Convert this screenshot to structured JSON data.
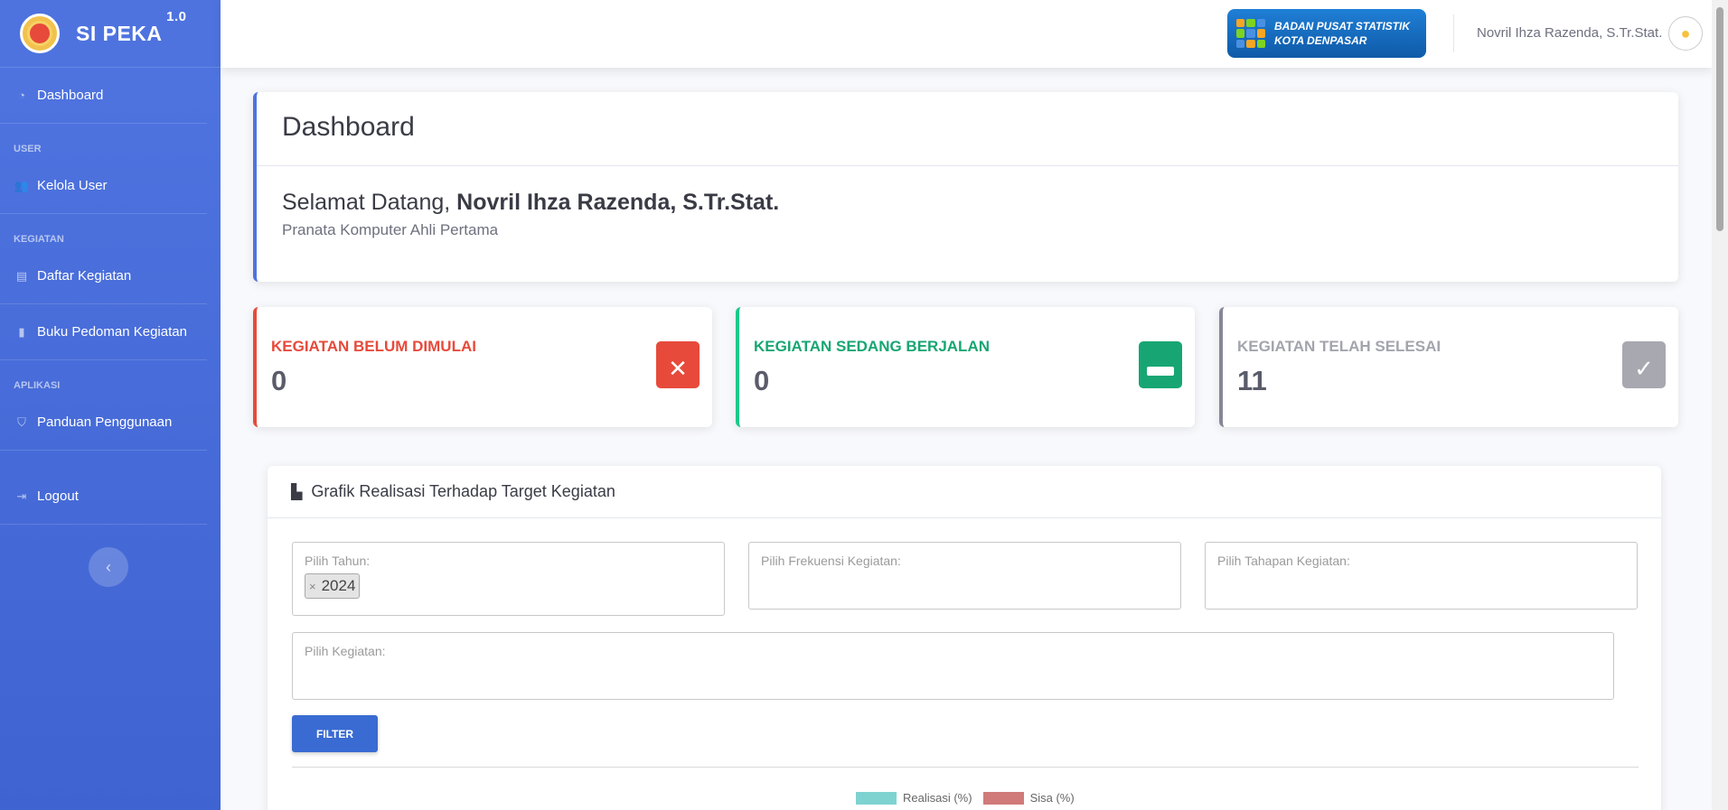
{
  "brand": {
    "name": "SI PEKA",
    "version": "1.0"
  },
  "sidebar": {
    "dashboard": "Dashboard",
    "heading_user": "USER",
    "kelola_user": "Kelola User",
    "heading_kegiatan": "KEGIATAN",
    "daftar_kegiatan": "Daftar Kegiatan",
    "buku_pedoman": "Buku Pedoman Kegiatan",
    "heading_aplikasi": "APLIKASI",
    "panduan": "Panduan Penggunaan",
    "logout": "Logout"
  },
  "topbar": {
    "bps_line1": "BADAN PUSAT STATISTIK",
    "bps_line2": "KOTA DENPASAR",
    "user_name": "Novril Ihza Razenda, S.Tr.Stat."
  },
  "welcome": {
    "title": "Dashboard",
    "greeting_prefix": "Selamat Datang, ",
    "greeting_name": "Novril Ihza Razenda, S.Tr.Stat.",
    "role": "Pranata Komputer Ahli Pertama"
  },
  "stats": [
    {
      "title": "KEGIATAN BELUM DIMULAI",
      "value": "0",
      "color": "#e74a3b",
      "icon": "calendar-x-icon"
    },
    {
      "title": "KEGIATAN SEDANG BERJALAN",
      "value": "0",
      "color": "#1cc88a",
      "icon": "calendar-minus-icon"
    },
    {
      "title": "KEGIATAN TELAH SELESAI",
      "value": "11",
      "color": "#858796",
      "icon": "calendar-check-icon"
    }
  ],
  "chart_section": {
    "title": "Grafik Realisasi Terhadap Target Kegiatan",
    "tahun_label": "Pilih Tahun:",
    "tahun_selected": "2024",
    "frekuensi_label": "Pilih Frekuensi Kegiatan:",
    "tahapan_label": "Pilih Tahapan Kegiatan:",
    "kegiatan_label": "Pilih Kegiatan:",
    "filter_button": "FILTER",
    "legend_realisasi": "Realisasi (%)",
    "legend_sisa": "Sisa (%)",
    "color_realisasi": "#7ed3d1",
    "color_sisa": "#d17a7a"
  }
}
